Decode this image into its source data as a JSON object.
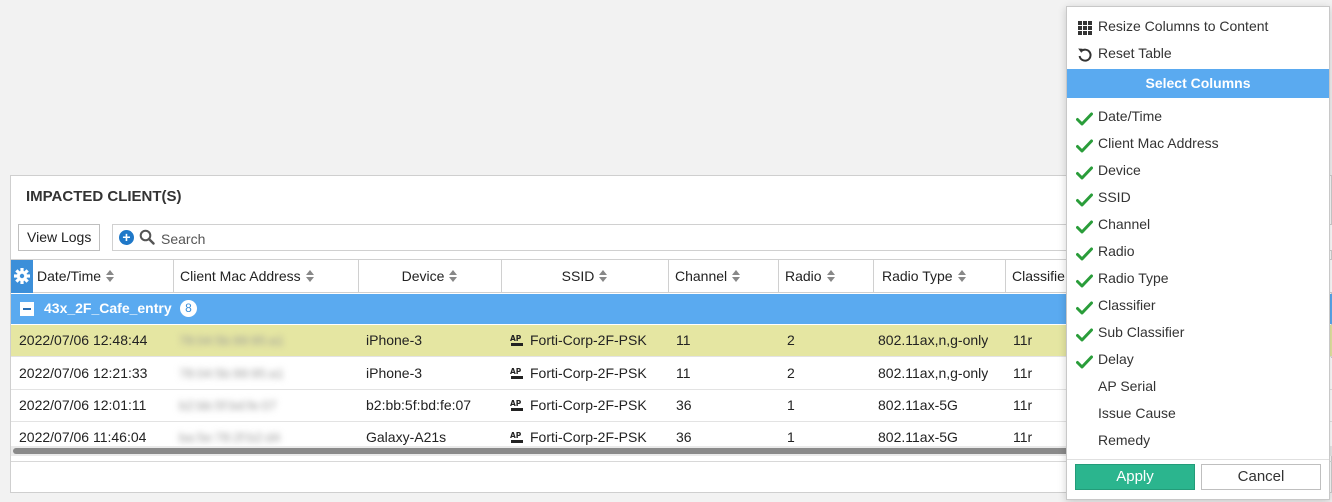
{
  "panel": {
    "title": "IMPACTED CLIENT(S)",
    "view_logs_label": "View Logs",
    "search_placeholder": "Search"
  },
  "table": {
    "columns": [
      "Date/Time",
      "Client Mac Address",
      "Device",
      "SSID",
      "Channel",
      "Radio",
      "Radio Type",
      "Classifie"
    ],
    "group": {
      "name": "43x_2F_Cafe_entry",
      "count": "8"
    },
    "rows": [
      {
        "datetime": "2022/07/06 12:48:44",
        "mac": "78:04:5b:99:95:a1",
        "device": "iPhone-3",
        "ssid": "Forti-Corp-2F-PSK",
        "channel": "11",
        "radio": "2",
        "radio_type": "802.11ax,n,g-only",
        "classifier": "11r"
      },
      {
        "datetime": "2022/07/06 12:21:33",
        "mac": "78:04:5b:99:95:a1",
        "device": "iPhone-3",
        "ssid": "Forti-Corp-2F-PSK",
        "channel": "11",
        "radio": "2",
        "radio_type": "802.11ax,n,g-only",
        "classifier": "11r"
      },
      {
        "datetime": "2022/07/06 12:01:11",
        "mac": "b2:bb:5f:bd:fe:07",
        "device": "b2:bb:5f:bd:fe:07",
        "ssid": "Forti-Corp-2F-PSK",
        "channel": "36",
        "radio": "1",
        "radio_type": "802.11ax-5G",
        "classifier": "11r"
      },
      {
        "datetime": "2022/07/06 11:46:04",
        "mac": "ba:5e:78:2f:b2:d4",
        "device": "Galaxy-A21s",
        "ssid": "Forti-Corp-2F-PSK",
        "channel": "36",
        "radio": "1",
        "radio_type": "802.11ax-5G",
        "classifier": "11r"
      }
    ]
  },
  "menu": {
    "resize_label": "Resize Columns to Content",
    "reset_label": "Reset Table",
    "header": "Select Columns",
    "columns": [
      {
        "label": "Date/Time",
        "checked": true
      },
      {
        "label": "Client Mac Address",
        "checked": true
      },
      {
        "label": "Device",
        "checked": true
      },
      {
        "label": "SSID",
        "checked": true
      },
      {
        "label": "Channel",
        "checked": true
      },
      {
        "label": "Radio",
        "checked": true
      },
      {
        "label": "Radio Type",
        "checked": true
      },
      {
        "label": "Classifier",
        "checked": true
      },
      {
        "label": "Sub Classifier",
        "checked": true
      },
      {
        "label": "Delay",
        "checked": true
      },
      {
        "label": "AP Serial",
        "checked": false
      },
      {
        "label": "Issue Cause",
        "checked": false
      },
      {
        "label": "Remedy",
        "checked": false
      }
    ],
    "apply_label": "Apply",
    "cancel_label": "Cancel"
  },
  "colors": {
    "accent": "#5aaaf0",
    "selected_row": "#e5e6a2",
    "apply": "#2bb58e",
    "check": "#2a9d3a"
  }
}
